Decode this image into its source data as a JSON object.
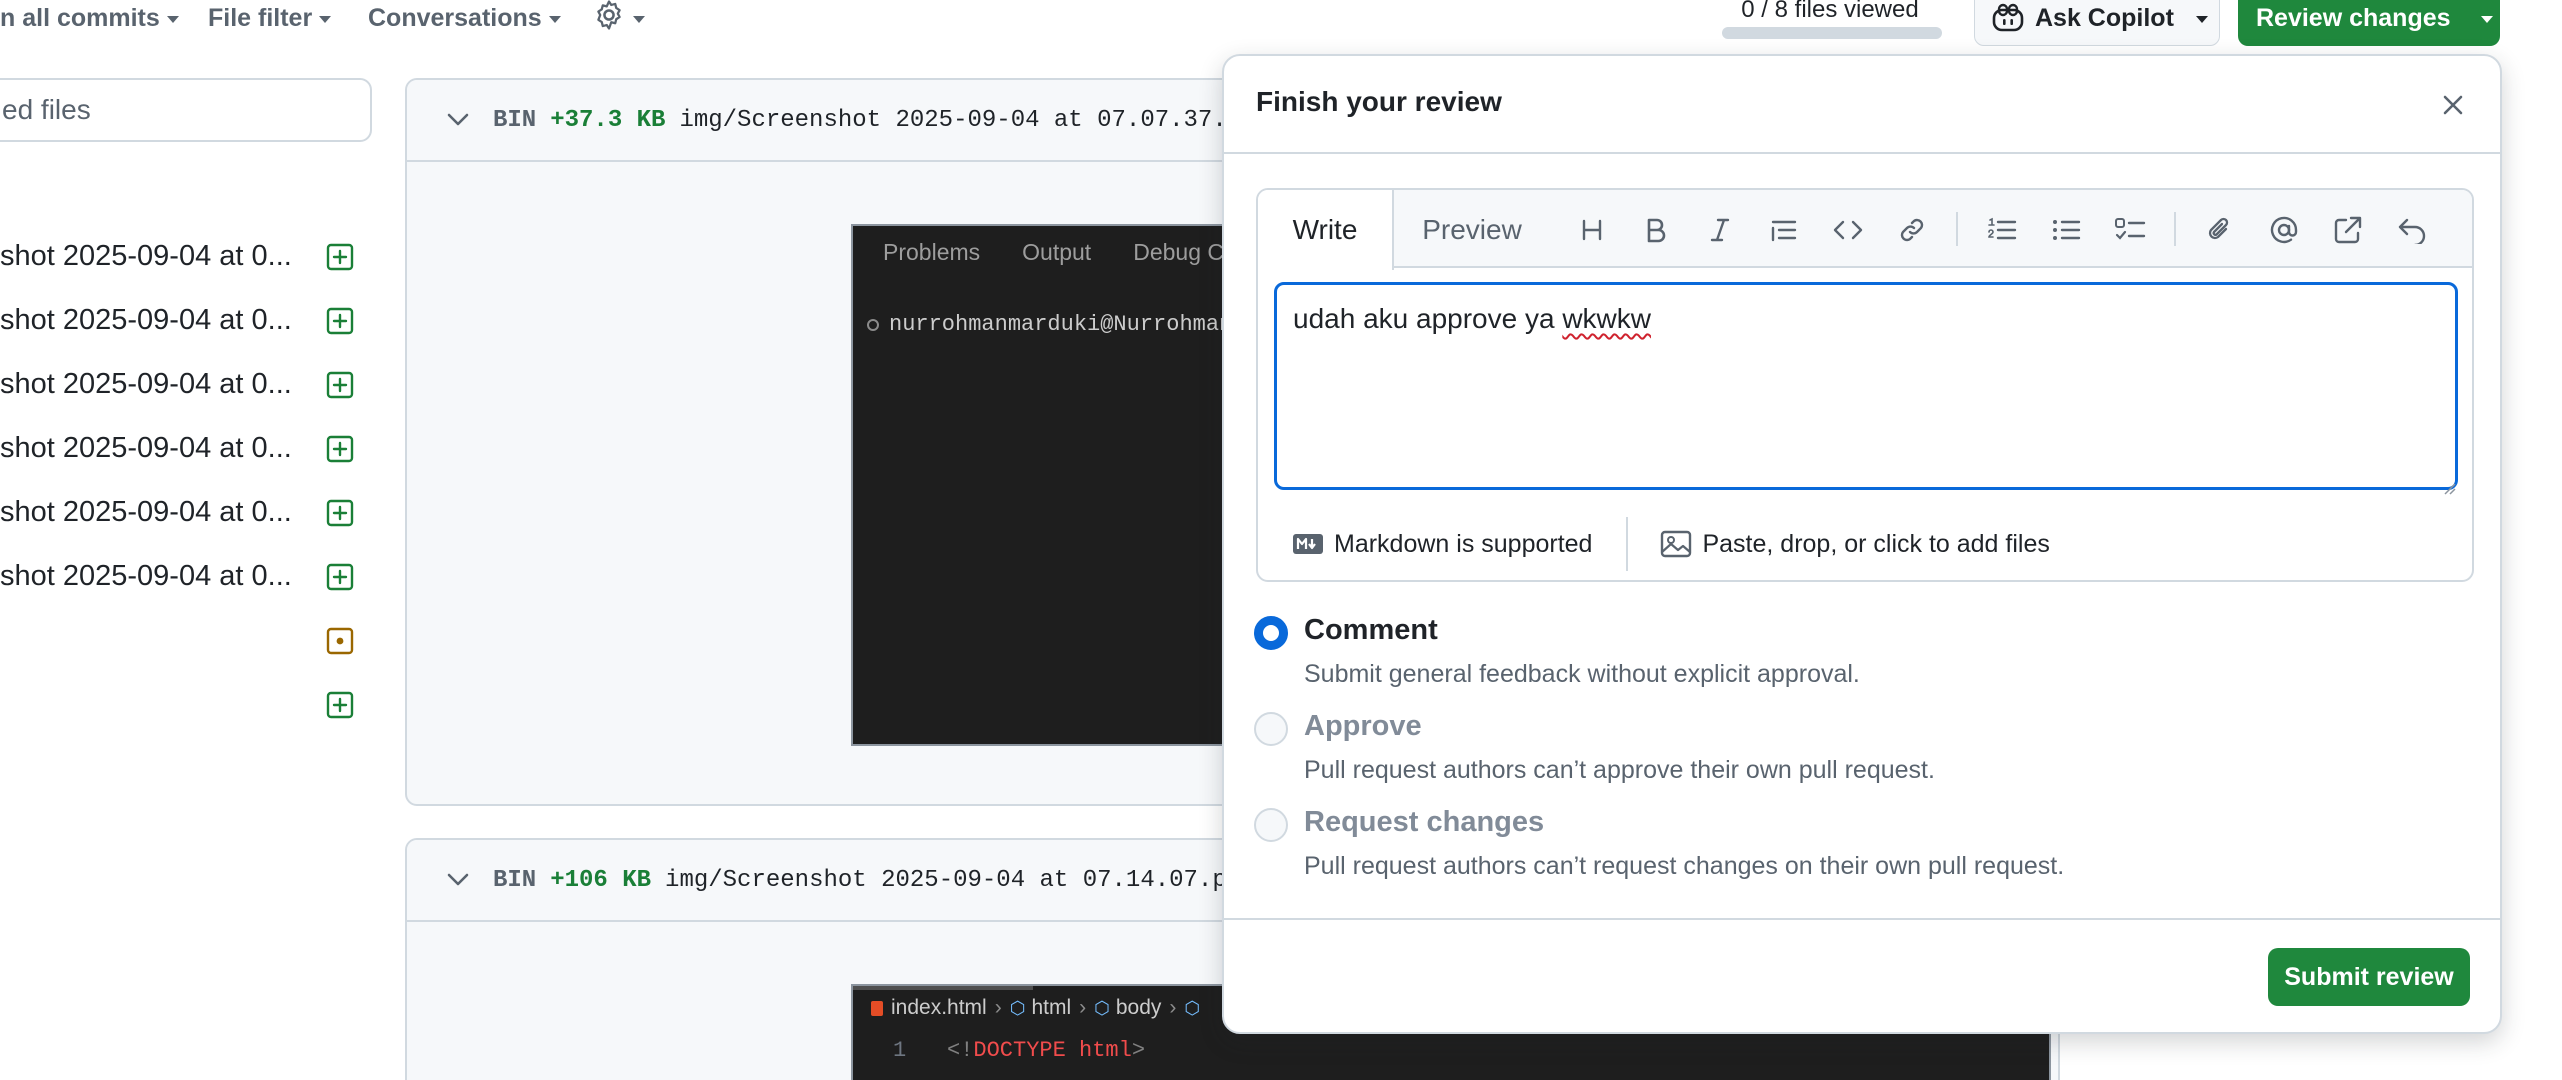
{
  "toolbar": {
    "commits_label": "n all commits",
    "file_filter_label": "File filter",
    "conversations_label": "Conversations",
    "files_viewed": "0 / 8 files viewed",
    "files_viewed_progress": 0.0,
    "ask_copilot_label": "Ask Copilot",
    "review_changes_label": "Review changes"
  },
  "sidebar": {
    "filter_placeholder": "ed files",
    "files": [
      {
        "name": "shot 2025-09-04 at 0...",
        "status": "added"
      },
      {
        "name": "shot 2025-09-04 at 0...",
        "status": "added"
      },
      {
        "name": "shot 2025-09-04 at 0...",
        "status": "added"
      },
      {
        "name": "shot 2025-09-04 at 0...",
        "status": "added"
      },
      {
        "name": "shot 2025-09-04 at 0...",
        "status": "added"
      },
      {
        "name": "shot 2025-09-04 at 0...",
        "status": "added"
      },
      {
        "name": "",
        "status": "modified"
      },
      {
        "name": "",
        "status": "added"
      }
    ],
    "colors": {
      "added": "#1a7f37",
      "modified": "#9a6700"
    }
  },
  "diffs": [
    {
      "bin": "BIN",
      "size": "+37.3 KB",
      "path": "img/Screenshot 2025-09-04 at 07.07.37.",
      "preview": {
        "tabs": [
          "Problems",
          "Output",
          "Debug C"
        ],
        "terminal_line": "nurrohmanmarduki@Nurrohman"
      }
    },
    {
      "bin": "BIN",
      "size": "+106 KB",
      "path": "img/Screenshot 2025-09-04 at 07.14.07.p",
      "preview": {
        "breadcrumb": [
          "index.html",
          "html",
          "body"
        ],
        "line_number": "1",
        "code_open": "<!",
        "code_doctype": "DOCTYPE",
        "code_html": "html",
        "code_close": ">"
      }
    }
  ],
  "review": {
    "title": "Finish your review",
    "tabs": {
      "write": "Write",
      "preview": "Preview"
    },
    "toolbar_icons": [
      "heading-icon",
      "bold-icon",
      "italic-icon",
      "quote-icon",
      "code-icon",
      "link-icon",
      "ordered-list-icon",
      "unordered-list-icon",
      "task-list-icon",
      "attach-icon",
      "mention-icon",
      "reference-icon",
      "undo-icon"
    ],
    "comment_text_plain": "udah aku approve ya ",
    "comment_text_flagged": "wkwkw",
    "markdown_note": "Markdown is supported",
    "attach_note": "Paste, drop, or click to add files",
    "options": [
      {
        "label": "Comment",
        "desc": "Submit general feedback without explicit approval.",
        "checked": true,
        "disabled": false
      },
      {
        "label": "Approve",
        "desc": "Pull request authors can’t approve their own pull request.",
        "checked": false,
        "disabled": true
      },
      {
        "label": "Request changes",
        "desc": "Pull request authors can’t request changes on their own pull request.",
        "checked": false,
        "disabled": true
      }
    ],
    "submit_label": "Submit review"
  }
}
